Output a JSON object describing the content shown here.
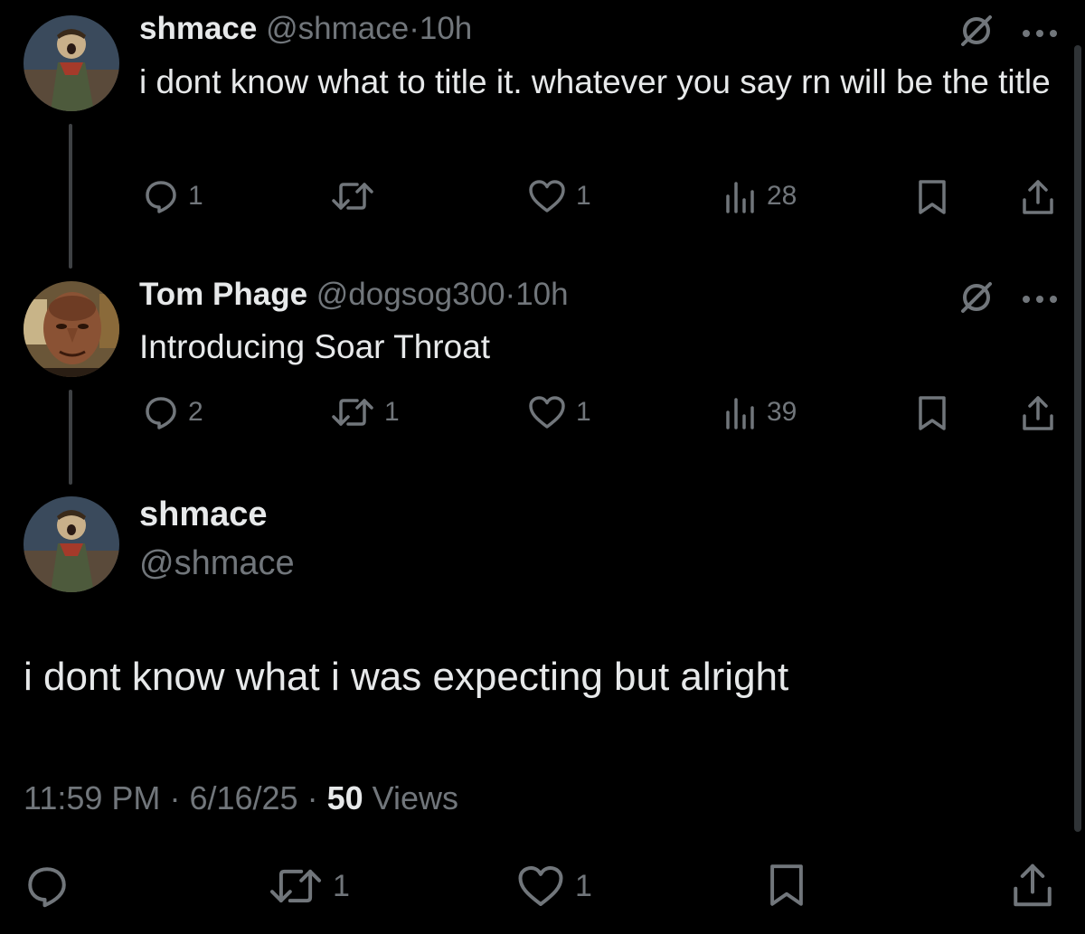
{
  "thread": {
    "tweet1": {
      "display_name": "shmace",
      "handle": "@shmace",
      "separator": "·",
      "time": "10h",
      "text": "i dont know what to title it. whatever you say rn will be the title",
      "replies": "1",
      "retweets": "",
      "likes": "1",
      "views": "28",
      "avatar": "avatar-shmace"
    },
    "tweet2": {
      "display_name": "Tom Phage",
      "handle": "@dogsog300",
      "separator": "·",
      "time": "10h",
      "text": "Introducing Soar Throat",
      "replies": "2",
      "retweets": "1",
      "likes": "1",
      "views": "39",
      "avatar": "avatar-tom-phage"
    },
    "main": {
      "display_name": "shmace",
      "handle": "@shmace",
      "text": "i dont know what i was expecting but alright",
      "time": "11:59 PM",
      "date": "6/16/25",
      "separator": "·",
      "views_count": "50",
      "views_label": "Views",
      "retweets": "1",
      "likes": "1"
    }
  },
  "colors": {
    "background": "#000000",
    "text_primary": "#e7e9ea",
    "text_muted": "#71767b",
    "thread_line": "#3e4144"
  }
}
